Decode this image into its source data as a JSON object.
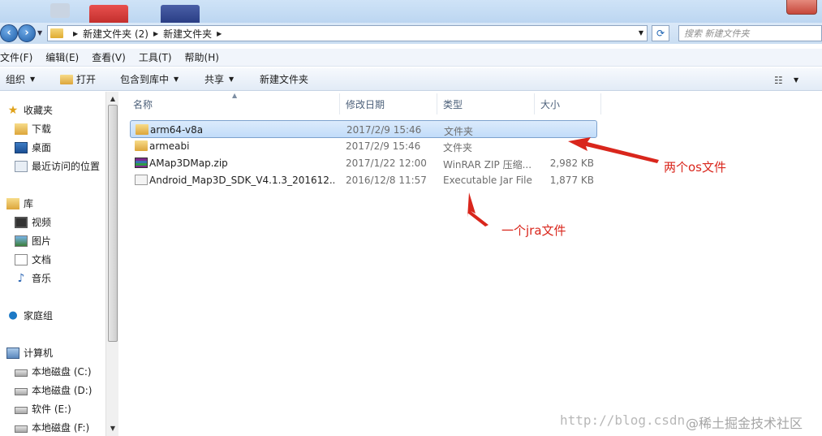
{
  "address_bar": {
    "crumbs": [
      "新建文件夹 (2)",
      "新建文件夹"
    ],
    "search_placeholder": "搜索 新建文件夹"
  },
  "menu": {
    "items": [
      "文件(F)",
      "编辑(E)",
      "查看(V)",
      "工具(T)",
      "帮助(H)"
    ]
  },
  "toolbar": {
    "organize": "组织",
    "open": "打开",
    "include_library": "包含到库中",
    "share": "共享",
    "new_folder": "新建文件夹"
  },
  "sidebar": {
    "favorites": "收藏夹",
    "downloads": "下载",
    "desktop": "桌面",
    "recent": "最近访问的位置",
    "libraries": "库",
    "videos": "视频",
    "pictures": "图片",
    "documents": "文档",
    "music": "音乐",
    "homegroup": "家庭组",
    "computer": "计算机",
    "drive_c": "本地磁盘 (C:)",
    "drive_d": "本地磁盘 (D:)",
    "drive_e": "软件 (E:)",
    "drive_f": "本地磁盘 (F:)"
  },
  "columns": {
    "name": "名称",
    "date": "修改日期",
    "type": "类型",
    "size": "大小"
  },
  "files": [
    {
      "name": "arm64-v8a",
      "date": "2017/2/9 15:46",
      "type": "文件夹",
      "size": "",
      "icon": "folder-icon",
      "selected": true
    },
    {
      "name": "armeabi",
      "date": "2017/2/9 15:46",
      "type": "文件夹",
      "size": "",
      "icon": "folder-icon",
      "selected": false
    },
    {
      "name": "AMap3DMap.zip",
      "date": "2017/1/22 12:00",
      "type": "WinRAR ZIP 压缩...",
      "size": "2,982 KB",
      "icon": "winrar-zip-icon",
      "selected": false
    },
    {
      "name": "Android_Map3D_SDK_V4.1.3_201612...",
      "date": "2016/12/8 11:57",
      "type": "Executable Jar File",
      "size": "1,877 KB",
      "icon": "jar-file-icon",
      "selected": false
    }
  ],
  "annotations": {
    "os_files": "两个os文件",
    "jar_file": "一个jra文件"
  },
  "watermark": {
    "url": "http://blog.csdn",
    "brand": "@稀土掘金技术社区"
  },
  "colors": {
    "annotation_red": "#d9261c",
    "selection_blue": "#c1dcf9"
  }
}
